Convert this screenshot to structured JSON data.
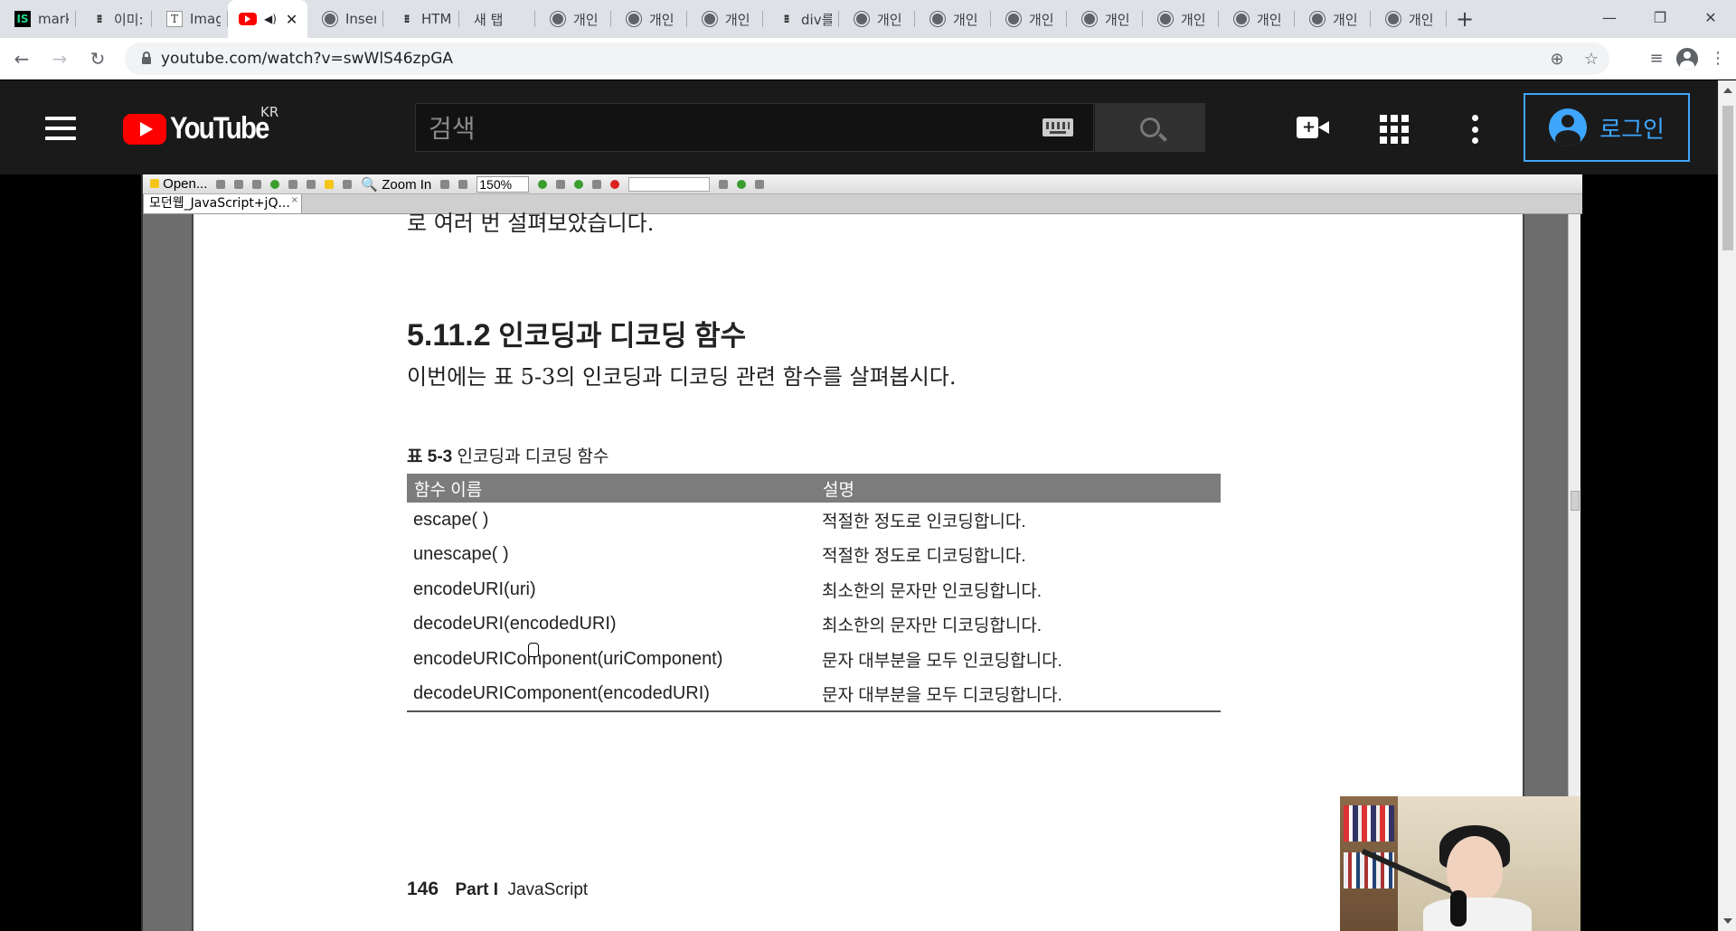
{
  "browser": {
    "tabs": [
      {
        "favicon": "intellij-icon",
        "title": "mark",
        "active": false
      },
      {
        "favicon": "dots-icon",
        "title": "이미:",
        "active": false
      },
      {
        "favicon": "t-icon",
        "title": "Imag",
        "active": false
      },
      {
        "favicon": "youtube-icon",
        "title": "",
        "active": true,
        "audio": true
      },
      {
        "favicon": "globe-icon",
        "title": "Inser",
        "active": false
      },
      {
        "favicon": "dots-icon",
        "title": "HTM",
        "active": false
      },
      {
        "favicon": "none",
        "title": "새 탭",
        "active": false
      },
      {
        "favicon": "globe-icon",
        "title": "개인",
        "active": false
      },
      {
        "favicon": "globe-icon",
        "title": "개인",
        "active": false
      },
      {
        "favicon": "globe-icon",
        "title": "개인",
        "active": false
      },
      {
        "favicon": "dots-icon",
        "title": "div를",
        "active": false
      },
      {
        "favicon": "globe-icon",
        "title": "개인",
        "active": false
      },
      {
        "favicon": "globe-icon",
        "title": "개인",
        "active": false
      },
      {
        "favicon": "globe-icon",
        "title": "개인",
        "active": false
      },
      {
        "favicon": "globe-icon",
        "title": "개인",
        "active": false
      },
      {
        "favicon": "globe-icon",
        "title": "개인",
        "active": false
      },
      {
        "favicon": "globe-icon",
        "title": "개인",
        "active": false
      },
      {
        "favicon": "globe-icon",
        "title": "개인",
        "active": false
      },
      {
        "favicon": "globe-icon",
        "title": "개인",
        "active": false
      }
    ],
    "url": "youtube.com/watch?v=swWlS46zpGA"
  },
  "youtube": {
    "logo_text": "YouTube",
    "region": "KR",
    "search_placeholder": "검색",
    "login_label": "로그인"
  },
  "viewer": {
    "toolbar": {
      "open_label": "Open...",
      "zoom_in_label": "Zoom In",
      "zoom_value": "150%"
    },
    "doc_tab": "모던웹_JavaScript+jQ..."
  },
  "page": {
    "prev_line": "로 여러 번 설펴보았습니다.",
    "section_number": "5.11.2",
    "section_title": "인코딩과 디코딩 함수",
    "intro": "이번에는 표 5-3의 인코딩과 디코딩 관련 함수를 살펴봅시다.",
    "table_caption_num": "표 5-3",
    "table_caption_text": "인코딩과 디코딩 함수",
    "table_headers": [
      "함수 이름",
      "설명"
    ],
    "table_rows": [
      [
        "escape( )",
        "적절한 정도로 인코딩합니다."
      ],
      [
        "unescape( )",
        "적절한 정도로 디코딩합니다."
      ],
      [
        "encodeURI(uri)",
        "최소한의 문자만 인코딩합니다."
      ],
      [
        "decodeURI(encodedURI)",
        "최소한의 문자만 디코딩합니다."
      ],
      [
        "encodeURIComponent(uriComponent)",
        "문자 대부분을 모두 인코딩합니다."
      ],
      [
        "decodeURIComponent(encodedURI)",
        "문자 대부분을 모두 디코딩합니다."
      ]
    ],
    "page_number": "146",
    "part_label": "Part I",
    "chapter_label": "JavaScript"
  }
}
